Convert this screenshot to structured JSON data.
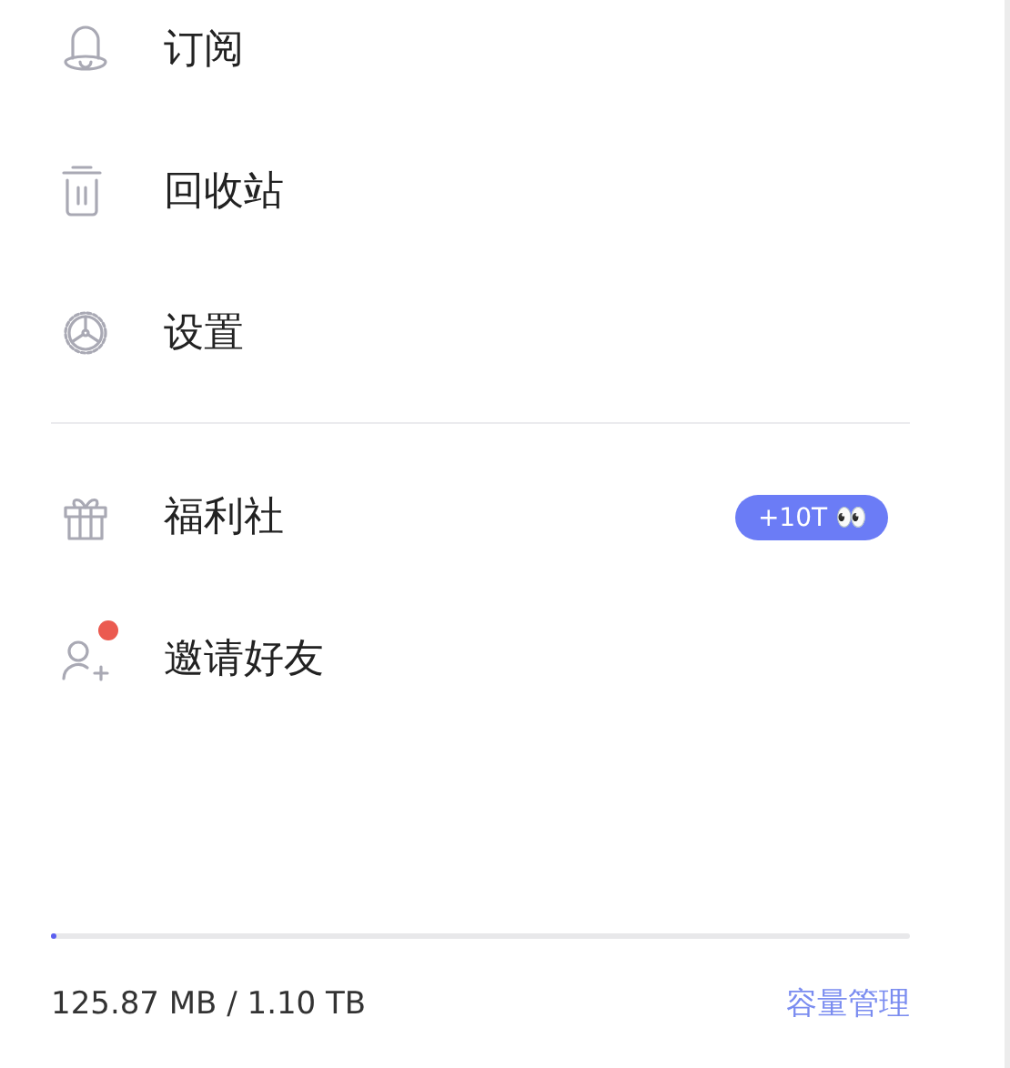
{
  "menu_groups": [
    {
      "items": [
        {
          "label": "订阅",
          "has_dot": false
        },
        {
          "label": "回收站",
          "has_dot": false
        },
        {
          "label": "设置",
          "has_dot": false
        }
      ]
    },
    {
      "items": [
        {
          "label": "福利社",
          "badge": "+10T 👀",
          "has_dot": false
        },
        {
          "label": "邀请好友",
          "has_dot": true
        }
      ]
    }
  ],
  "storage": {
    "level": 0.006,
    "usage": "125.87 MB / 1.10 TB",
    "manage_link": "容量管理"
  }
}
